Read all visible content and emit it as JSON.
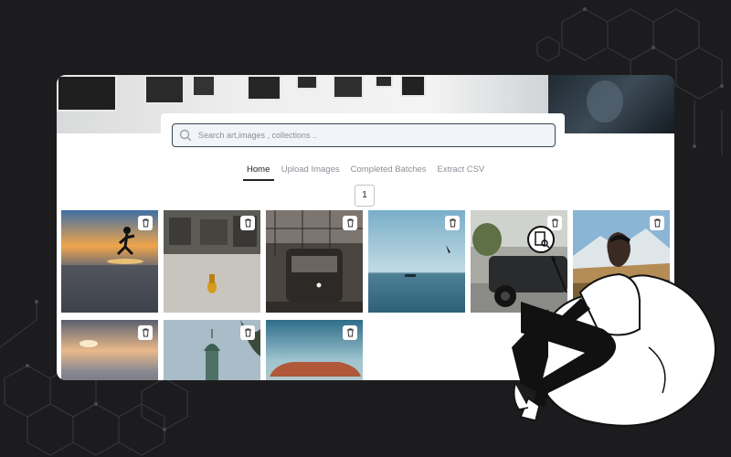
{
  "search": {
    "placeholder": "Search art,images , collections .."
  },
  "tabs": [
    {
      "label": "Home",
      "active": true
    },
    {
      "label": "Upload Images",
      "active": false
    },
    {
      "label": "Completed Batches",
      "active": false
    },
    {
      "label": "Extract CSV",
      "active": false
    }
  ],
  "pagination": {
    "current_page": "1"
  },
  "gallery": [
    {
      "icon": "trash-icon",
      "scene": "sunset-beach-runner"
    },
    {
      "icon": "trash-icon",
      "scene": "rainy-street-buoy"
    },
    {
      "icon": "trash-icon",
      "scene": "train-station"
    },
    {
      "icon": "trash-icon",
      "scene": "calm-sea-boat"
    },
    {
      "icon": "trash-icon",
      "scene": "offroad-vehicle"
    },
    {
      "icon": "trash-icon",
      "scene": "snowy-mountain"
    },
    {
      "icon": "trash-icon",
      "scene": "sea-sunset"
    },
    {
      "icon": "trash-icon",
      "scene": "tower-dome"
    },
    {
      "icon": "trash-icon",
      "scene": "red-rock-formation"
    }
  ],
  "colors": {
    "background": "#1c1c1e",
    "card": "#ffffff",
    "search_border": "#3b4453",
    "accent_text": "#1c1c1c",
    "muted_text": "#8b8f96"
  }
}
